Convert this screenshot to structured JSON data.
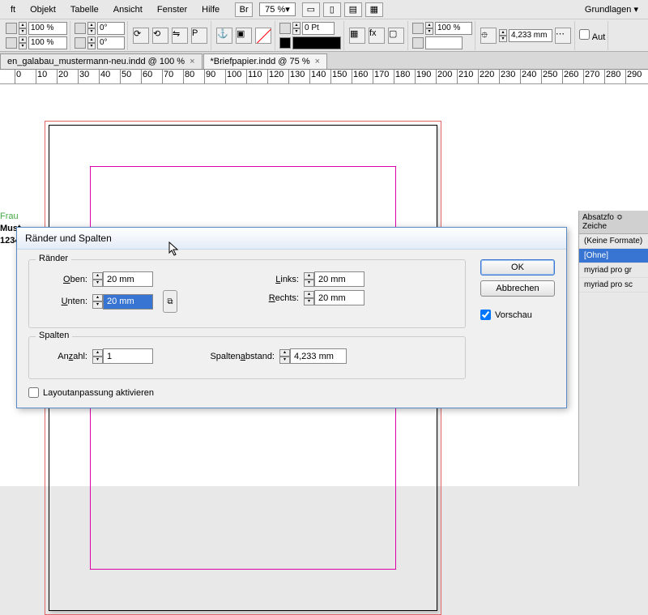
{
  "menu": {
    "items": [
      "ft",
      "Objekt",
      "Tabelle",
      "Ansicht",
      "Fenster",
      "Hilfe"
    ],
    "zoom": "75 %",
    "workspace": "Grundlagen"
  },
  "toolbar": {
    "scaleX": "100 %",
    "scaleY": "100 %",
    "rot1": "0°",
    "rot2": "0°",
    "stroke": "0 Pt",
    "scale3": "100 %",
    "dim": "4,233 mm",
    "auto": "Aut"
  },
  "tabs": [
    {
      "label": "en_galabau_mustermann-neu.indd @ 100 %",
      "active": false
    },
    {
      "label": "*Briefpapier.indd @ 75 %",
      "active": true
    }
  ],
  "ruler": [
    0,
    10,
    20,
    30,
    40,
    50,
    60,
    70,
    80,
    90,
    100,
    110,
    120,
    130,
    140,
    150,
    160,
    170,
    180,
    190,
    200,
    210,
    220,
    230,
    240,
    250,
    260,
    270,
    280,
    290
  ],
  "sidetext": {
    "l1": "Frau",
    "l2": "Must",
    "l3": "1234"
  },
  "panel": {
    "tab": "Absatzfo ≎ Zeiche",
    "rows": [
      "(Keine Formate)",
      "[Ohne]",
      "myriad pro gr",
      "myriad pro sc"
    ]
  },
  "dialog": {
    "title": "Ränder und Spalten",
    "margins": {
      "legend": "Ränder",
      "top_l": "Oben:",
      "top_v": "20 mm",
      "bottom_l": "Unten:",
      "bottom_v": "20 mm",
      "left_l": "Links:",
      "left_v": "20 mm",
      "right_l": "Rechts:",
      "right_v": "20 mm"
    },
    "columns": {
      "legend": "Spalten",
      "count_l": "Anzahl:",
      "count_v": "1",
      "gutter_l": "Spaltenabstand:",
      "gutter_v": "4,233 mm"
    },
    "layout_l": "Layoutanpassung aktivieren",
    "ok": "OK",
    "cancel": "Abbrechen",
    "preview": "Vorschau"
  }
}
